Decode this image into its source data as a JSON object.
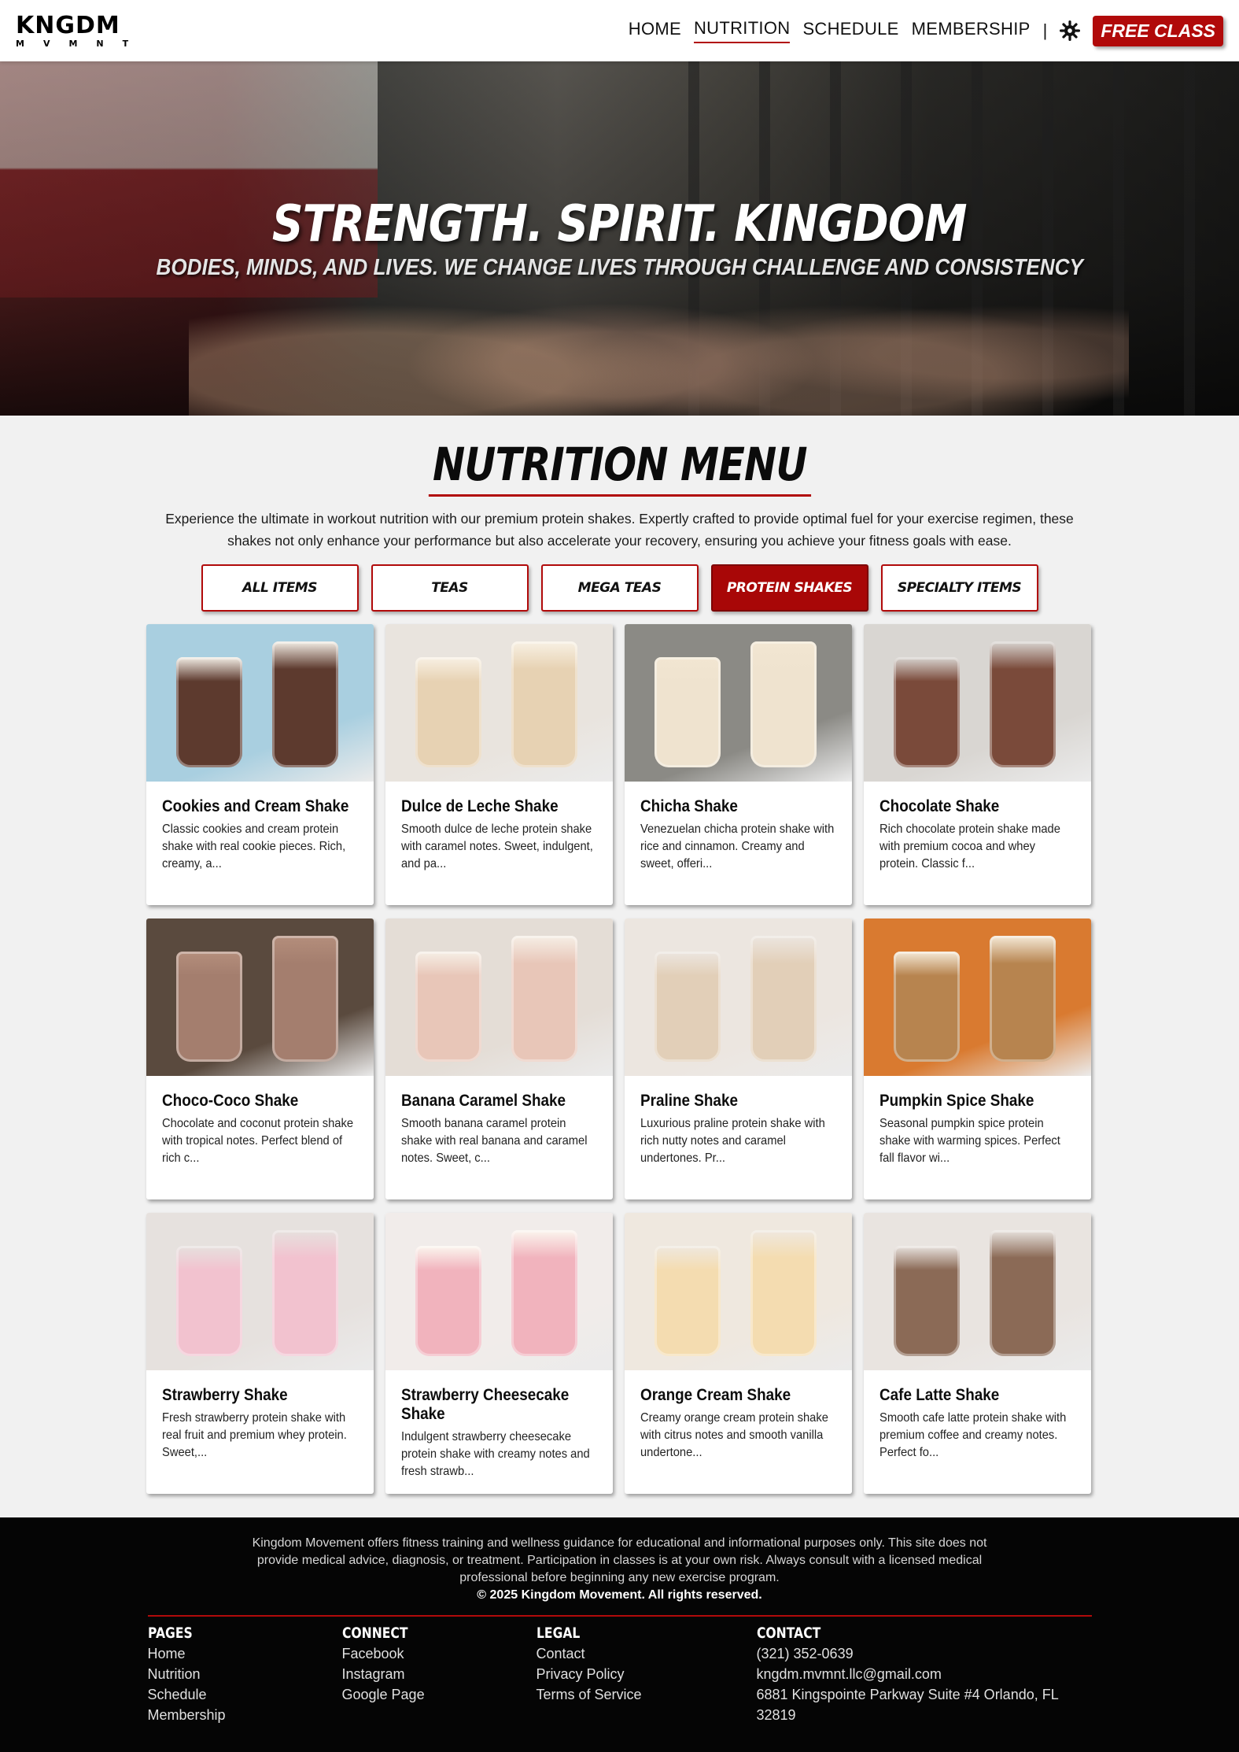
{
  "header": {
    "logo_main": "KNGDM",
    "logo_sub": "MVMNT",
    "nav": [
      {
        "label": "HOME",
        "active": false
      },
      {
        "label": "NUTRITION",
        "active": true
      },
      {
        "label": "SCHEDULE",
        "active": false
      },
      {
        "label": "MEMBERSHIP",
        "active": false
      }
    ],
    "separator": "|",
    "theme_icon": "gear-icon",
    "cta_label": "FREE CLASS",
    "accent_color": "#b10a0a"
  },
  "hero": {
    "title": "STRENGTH. SPIRIT. KINGDOM",
    "subtitle": "BODIES, MINDS, AND LIVES. WE CHANGE LIVES THROUGH CHALLENGE AND CONSISTENCY"
  },
  "menu": {
    "title": "NUTRITION MENU",
    "intro": "Experience the ultimate in workout nutrition with our premium protein shakes. Expertly crafted to provide optimal fuel for your exercise regimen, these shakes not only enhance your performance but also accelerate your recovery, ensuring you achieve your fitness goals with ease.",
    "filters": [
      {
        "label": "ALL ITEMS",
        "active": false
      },
      {
        "label": "TEAS",
        "active": false
      },
      {
        "label": "MEGA TEAS",
        "active": false
      },
      {
        "label": "PROTEIN SHAKES",
        "active": true
      },
      {
        "label": "SPECIALTY ITEMS",
        "active": false
      }
    ],
    "items": [
      {
        "name": "Cookies and Cream Shake",
        "desc": "Classic cookies and cream protein shake with real cookie pieces. Rich, creamy, a...",
        "bg": "#a9cfe0",
        "drink": "#5d3a2e",
        "cream": "#f3eee6"
      },
      {
        "name": "Dulce de Leche Shake",
        "desc": "Smooth dulce de leche protein shake with caramel notes. Sweet, indulgent, and pa...",
        "bg": "#e9e4de",
        "drink": "#e7d2b3",
        "cream": "#f8f1e4"
      },
      {
        "name": "Chicha Shake",
        "desc": "Venezuelan chicha protein shake with rice and cinnamon. Creamy and sweet, offeri...",
        "bg": "#8b8a85",
        "drink": "#efe3cf",
        "cream": "#f2e6d2"
      },
      {
        "name": "Chocolate Shake",
        "desc": "Rich chocolate protein shake made with premium cocoa and whey protein. Classic f...",
        "bg": "#d9d6d2",
        "drink": "#7a4a3a",
        "cream": "#d9d6d2"
      },
      {
        "name": "Choco-Coco Shake",
        "desc": "Chocolate and coconut protein shake with tropical notes. Perfect blend of rich c...",
        "bg": "#5a4a3e",
        "drink": "#a47e6e",
        "cream": "#b48e7c"
      },
      {
        "name": "Banana Caramel Shake",
        "desc": "Smooth banana caramel protein shake with real banana and caramel notes. Sweet, c...",
        "bg": "#e4ddd6",
        "drink": "#e8c6b8",
        "cream": "#f6efe6"
      },
      {
        "name": "Praline Shake",
        "desc": "Luxurious praline protein shake with rich nutty notes and caramel undertones. Pr...",
        "bg": "#ece6e0",
        "drink": "#e2cfb8",
        "cream": "#ece6e0"
      },
      {
        "name": "Pumpkin Spice Shake",
        "desc": "Seasonal pumpkin spice protein shake with warming spices. Perfect fall flavor wi...",
        "bg": "#d97a30",
        "drink": "#b7844f",
        "cream": "#f5ead8"
      },
      {
        "name": "Strawberry Shake",
        "desc": "Fresh strawberry protein shake with real fruit and premium whey protein. Sweet,...",
        "bg": "#e6e1de",
        "drink": "#f2c2cf",
        "cream": "#e6e1de"
      },
      {
        "name": "Strawberry Cheesecake Shake",
        "desc": "Indulgent strawberry cheesecake protein shake with creamy notes and fresh strawb...",
        "bg": "#f1ecea",
        "drink": "#f1b3bd",
        "cream": "#fbf6ef"
      },
      {
        "name": "Orange Cream Shake",
        "desc": "Creamy orange cream protein shake with citrus notes and smooth vanilla undertone...",
        "bg": "#efe8df",
        "drink": "#f4dcb0",
        "cream": "#efe8df"
      },
      {
        "name": "Cafe Latte Shake",
        "desc": "Smooth cafe latte protein shake with premium coffee and creamy notes. Perfect fo...",
        "bg": "#e9e4e0",
        "drink": "#8b6a56",
        "cream": "#e9e4e0"
      }
    ]
  },
  "footer": {
    "disclaimer": "Kingdom Movement offers fitness training and wellness guidance for educational and informational purposes only. This site does not provide medical advice, diagnosis, or treatment. Participation in classes is at your own risk. Always consult with a licensed medical professional before beginning any new exercise program.",
    "copyright": "© 2025 Kingdom Movement. All rights reserved.",
    "columns": [
      {
        "title": "PAGES",
        "links": [
          "Home",
          "Nutrition",
          "Schedule",
          "Membership"
        ]
      },
      {
        "title": "CONNECT",
        "links": [
          "Facebook",
          "Instagram",
          "Google Page"
        ]
      },
      {
        "title": "LEGAL",
        "links": [
          "Contact",
          "Privacy Policy",
          "Terms of Service"
        ]
      },
      {
        "title": "CONTACT",
        "links": [
          "(321) 352-0639",
          "kngdm.mvmnt.llc@gmail.com",
          "6881 Kingspointe Parkway Suite #4 Orlando, FL 32819"
        ]
      }
    ]
  }
}
